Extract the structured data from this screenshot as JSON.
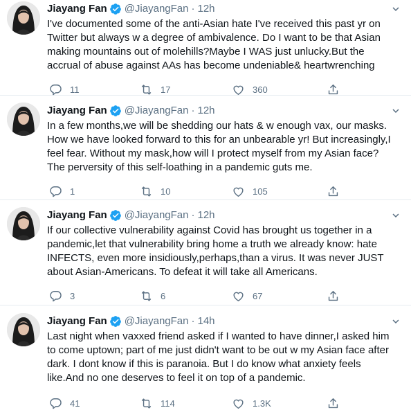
{
  "tweets": [
    {
      "name": "Jiayang Fan",
      "handle": "@JiayangFan",
      "dot": "·",
      "time": "12h",
      "text": "I've documented some of the anti-Asian hate I've received this past yr on\nTwitter but always w a degree of ambivalence. Do I want to be that Asian\nmaking mountains out of molehills?Maybe I WAS just unlucky.But the\naccrual of abuse against AAs has become undeniable& heartwrenching",
      "replies": "11",
      "retweets": "17",
      "likes": "360"
    },
    {
      "name": "Jiayang Fan",
      "handle": "@JiayangFan",
      "dot": "·",
      "time": "12h",
      "text": "In a few months,we will be shedding our hats & w enough vax, our masks.\nHow we have looked forward to this for an unbearable yr! But increasingly,I\nfeel fear. Without my mask,how will I protect myself from my Asian face?\nThe perversity of this self-loathing in a pandemic guts me.",
      "replies": "1",
      "retweets": "10",
      "likes": "105"
    },
    {
      "name": "Jiayang Fan",
      "handle": "@JiayangFan",
      "dot": "·",
      "time": "12h",
      "text": "If our collective vulnerability against Covid has brought us together in a\npandemic,let that vulnerability bring home a truth we already know: hate\nINFECTS, even more insidiously,perhaps,than a virus. It was never JUST\nabout Asian-Americans. To defeat it will take all Americans.",
      "replies": "3",
      "retweets": "6",
      "likes": "67"
    },
    {
      "name": "Jiayang Fan",
      "handle": "@JiayangFan",
      "dot": "·",
      "time": "14h",
      "text": "Last night when vaxxed friend asked if I wanted to have dinner,I asked him\nto come uptown; part of me just didn't want to be out w my Asian face after\ndark. I dont know if this is paranoia. But I do know what anxiety feels\nlike.And no one deserves to feel it on top of a pandemic.",
      "replies": "41",
      "retweets": "114",
      "likes": "1.3K"
    }
  ],
  "colors": {
    "text": "#0f1419",
    "muted": "#5b7083",
    "verified": "#1da1f2",
    "divider": "#e6ecf0"
  },
  "icons": {
    "avatar": "avatar",
    "verified": "verified-badge-icon",
    "more": "more-options-icon",
    "reply": "reply-icon",
    "retweet": "retweet-icon",
    "like": "like-icon",
    "share": "share-icon"
  }
}
